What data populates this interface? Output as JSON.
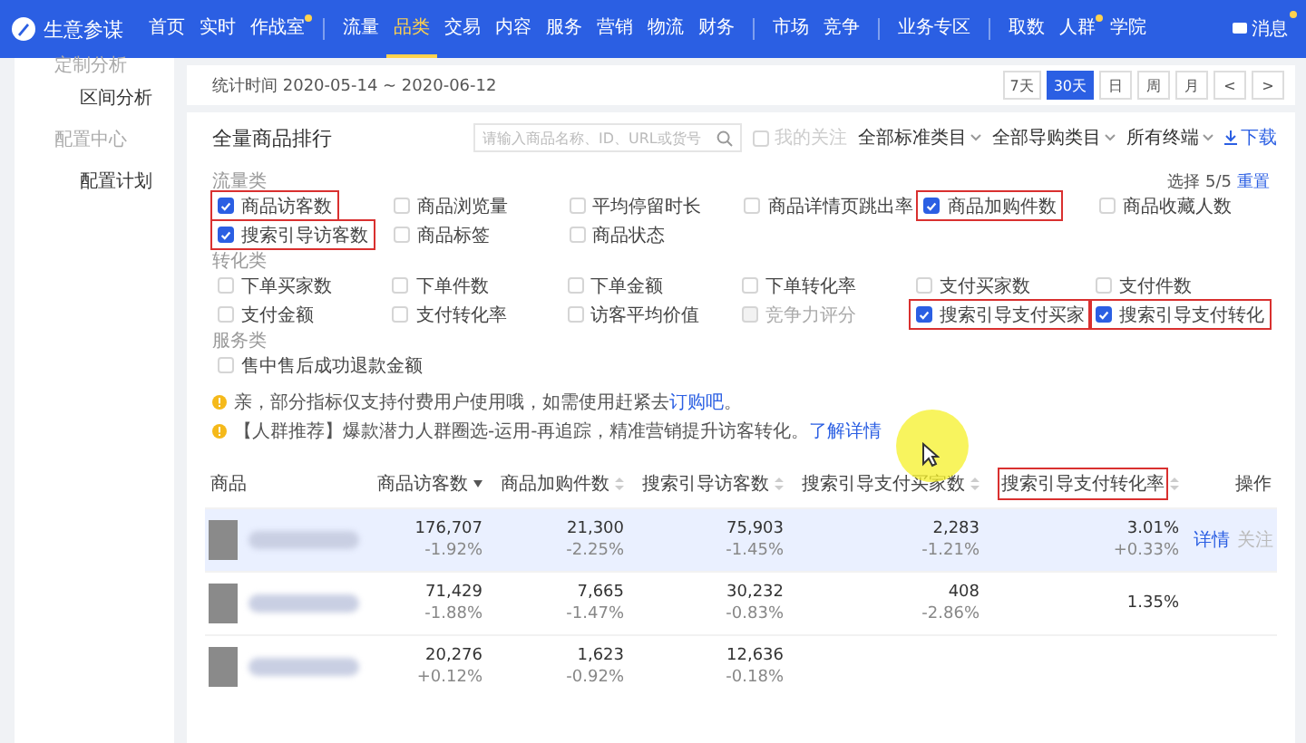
{
  "nav": {
    "brand": "生意参谋",
    "groups": [
      [
        {
          "label": "首页",
          "selected": false,
          "dot": false
        },
        {
          "label": "实时",
          "selected": false,
          "dot": false
        },
        {
          "label": "作战室",
          "selected": false,
          "dot": true
        }
      ],
      [
        {
          "label": "流量",
          "selected": false,
          "dot": false
        },
        {
          "label": "品类",
          "selected": true,
          "dot": false
        },
        {
          "label": "交易",
          "selected": false,
          "dot": false
        },
        {
          "label": "内容",
          "selected": false,
          "dot": false
        },
        {
          "label": "服务",
          "selected": false,
          "dot": false
        },
        {
          "label": "营销",
          "selected": false,
          "dot": false
        },
        {
          "label": "物流",
          "selected": false,
          "dot": false
        },
        {
          "label": "财务",
          "selected": false,
          "dot": false
        }
      ],
      [
        {
          "label": "市场",
          "selected": false,
          "dot": false
        },
        {
          "label": "竞争",
          "selected": false,
          "dot": false
        }
      ],
      [
        {
          "label": "业务专区",
          "selected": false,
          "dot": false
        }
      ],
      [
        {
          "label": "取数",
          "selected": false,
          "dot": false
        },
        {
          "label": "人群",
          "selected": false,
          "dot": true
        },
        {
          "label": "学院",
          "selected": false,
          "dot": false
        }
      ]
    ],
    "message": {
      "label": "消息",
      "dot": true
    }
  },
  "sidebar": {
    "items": [
      {
        "label": "定制分析",
        "kind": "section"
      },
      {
        "label": "区间分析",
        "kind": "link"
      },
      {
        "label": "配置中心",
        "kind": "section"
      },
      {
        "label": "配置计划",
        "kind": "link"
      }
    ]
  },
  "date_bar": {
    "text": "统计时间 2020-05-14 ~ 2020-06-12",
    "buttons": [
      {
        "label": "7天",
        "selected": false
      },
      {
        "label": "30天",
        "selected": true
      },
      {
        "label": "日",
        "selected": false
      },
      {
        "label": "周",
        "selected": false
      },
      {
        "label": "月",
        "selected": false
      },
      {
        "label": "<",
        "selected": false
      },
      {
        "label": ">",
        "selected": false
      }
    ]
  },
  "ranking": {
    "title": "全量商品排行",
    "search": {
      "placeholder": "请输入商品名称、ID、URL或货号"
    },
    "follow": {
      "label": "我的关注",
      "checked": false,
      "disabled": true
    },
    "filters": [
      "全部标准类目",
      "全部导购类目",
      "所有终端"
    ],
    "download": "下载",
    "selection": {
      "text": "选择 5/5",
      "reset": "重置"
    },
    "metric_groups": [
      {
        "label": "流量类",
        "items": [
          {
            "label": "商品访客数",
            "checked": true,
            "disabled": false,
            "annotated": true
          },
          {
            "label": "商品浏览量",
            "checked": false,
            "disabled": false,
            "annotated": false
          },
          {
            "label": "平均停留时长",
            "checked": false,
            "disabled": false,
            "annotated": false
          },
          {
            "label": "商品详情页跳出率",
            "checked": false,
            "disabled": false,
            "annotated": false
          },
          {
            "label": "商品加购件数",
            "checked": true,
            "disabled": false,
            "annotated": true
          },
          {
            "label": "商品收藏人数",
            "checked": false,
            "disabled": false,
            "annotated": false
          },
          {
            "label": "搜索引导访客数",
            "checked": true,
            "disabled": false,
            "annotated": true
          },
          {
            "label": "商品标签",
            "checked": false,
            "disabled": false,
            "annotated": false
          },
          {
            "label": "商品状态",
            "checked": false,
            "disabled": false,
            "annotated": false
          }
        ]
      },
      {
        "label": "转化类",
        "items": [
          {
            "label": "下单买家数",
            "checked": false,
            "disabled": false,
            "annotated": false
          },
          {
            "label": "下单件数",
            "checked": false,
            "disabled": false,
            "annotated": false
          },
          {
            "label": "下单金额",
            "checked": false,
            "disabled": false,
            "annotated": false
          },
          {
            "label": "下单转化率",
            "checked": false,
            "disabled": false,
            "annotated": false
          },
          {
            "label": "支付买家数",
            "checked": false,
            "disabled": false,
            "annotated": false
          },
          {
            "label": "支付件数",
            "checked": false,
            "disabled": false,
            "annotated": false
          },
          {
            "label": "支付金额",
            "checked": false,
            "disabled": false,
            "annotated": false
          },
          {
            "label": "支付转化率",
            "checked": false,
            "disabled": false,
            "annotated": false
          },
          {
            "label": "访客平均价值",
            "checked": false,
            "disabled": false,
            "annotated": false
          },
          {
            "label": "竞争力评分",
            "checked": false,
            "disabled": true,
            "annotated": false
          },
          {
            "label": "搜索引导支付买家",
            "checked": true,
            "disabled": false,
            "annotated": true
          },
          {
            "label": "搜索引导支付转化",
            "checked": true,
            "disabled": false,
            "annotated": true
          }
        ]
      },
      {
        "label": "服务类",
        "items": [
          {
            "label": "售中售后成功退款金额",
            "checked": false,
            "disabled": false,
            "annotated": false
          }
        ]
      }
    ],
    "notices": [
      {
        "text": "亲，部分指标仅支持付费用户使用哦，如需使用赶紧去",
        "link": "订购吧",
        "tail": "。"
      },
      {
        "text": "【人群推荐】爆款潜力人群圈选-运用-再追踪，精准营销提升访客转化。",
        "link": "了解详情"
      }
    ],
    "table": {
      "columns": [
        {
          "label": "商品",
          "sortable": false,
          "annotated": false
        },
        {
          "label": "商品访客数",
          "sortable": true,
          "sorted": true,
          "annotated": false
        },
        {
          "label": "商品加购件数",
          "sortable": true,
          "sorted": false,
          "annotated": false
        },
        {
          "label": "搜索引导访客数",
          "sortable": true,
          "sorted": false,
          "annotated": false
        },
        {
          "label": "搜索引导支付买家数",
          "sortable": true,
          "sorted": false,
          "annotated": false
        },
        {
          "label": "搜索引导支付转化率",
          "sortable": true,
          "sorted": false,
          "annotated": true
        },
        {
          "label": "操作",
          "sortable": false,
          "annotated": false
        }
      ],
      "rows": [
        {
          "selected": true,
          "cells": [
            {
              "kind": "product"
            },
            {
              "kind": "metric",
              "value": "176,707",
              "change": "-1.92%"
            },
            {
              "kind": "metric",
              "value": "21,300",
              "change": "-2.25%"
            },
            {
              "kind": "metric",
              "value": "75,903",
              "change": "-1.45%"
            },
            {
              "kind": "metric",
              "value": "2,283",
              "change": "-1.21%"
            },
            {
              "kind": "metric",
              "value": "3.01%",
              "change": "+0.33%"
            },
            {
              "kind": "actions",
              "links": [
                "详情",
                "关注"
              ]
            }
          ]
        },
        {
          "selected": false,
          "cells": [
            {
              "kind": "product"
            },
            {
              "kind": "metric",
              "value": "71,429",
              "change": "-1.88%"
            },
            {
              "kind": "metric",
              "value": "7,665",
              "change": "-1.47%"
            },
            {
              "kind": "metric",
              "value": "30,232",
              "change": "-0.83%"
            },
            {
              "kind": "metric",
              "value": "408",
              "change": "-2.86%"
            },
            {
              "kind": "metric",
              "value": "1.35%"
            },
            {
              "kind": "actions"
            }
          ]
        },
        {
          "selected": false,
          "cells": [
            {
              "kind": "product"
            },
            {
              "kind": "metric",
              "value": "20,276",
              "change": "+0.12%"
            },
            {
              "kind": "metric",
              "value": "1,623",
              "change": "-0.92%"
            },
            {
              "kind": "metric",
              "value": "12,636",
              "change": "-0.18%"
            },
            {
              "kind": "metric"
            },
            {
              "kind": "metric"
            },
            {
              "kind": "actions"
            }
          ]
        }
      ]
    }
  }
}
